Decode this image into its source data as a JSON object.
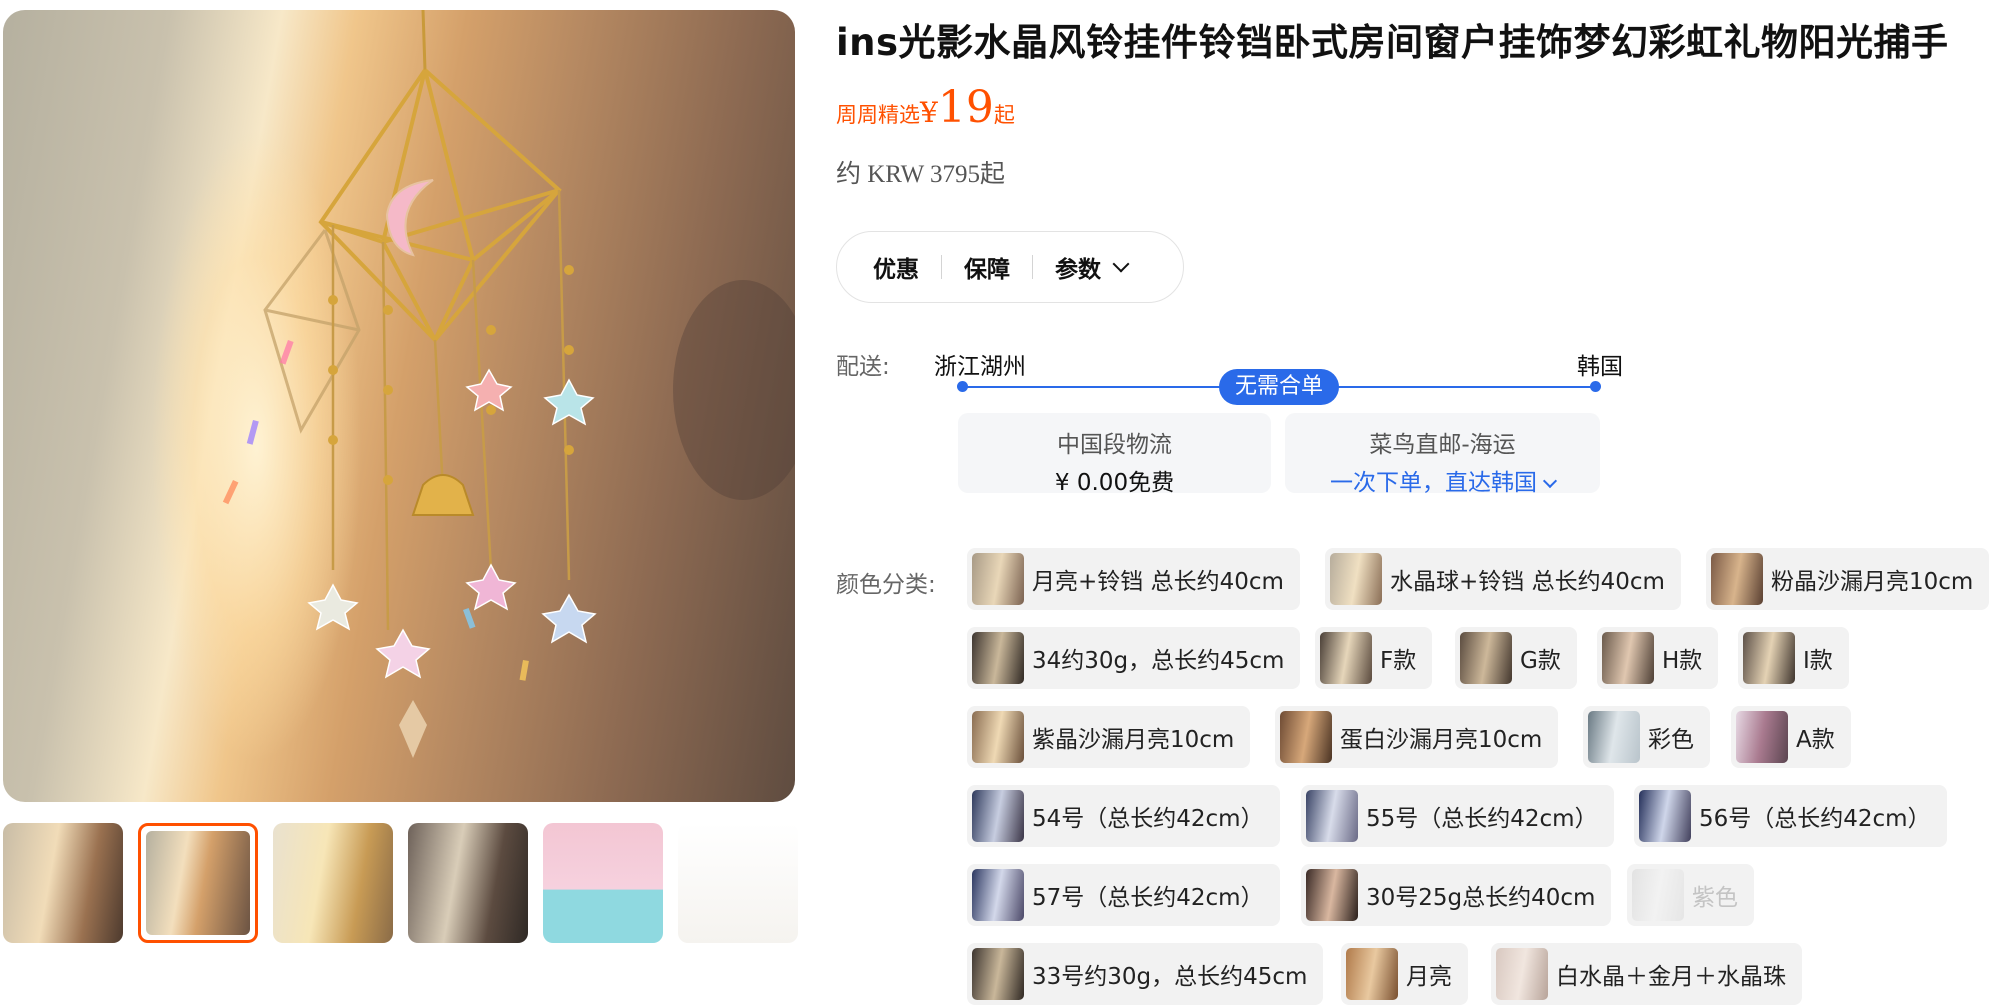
{
  "product": {
    "title": "ins光影水晶风铃挂件铃铛卧式房间窗户挂饰梦幻彩虹礼物阳光捕手",
    "price_tag": "周周精选",
    "currency_symbol": "¥",
    "price": "19",
    "price_suffix": "起",
    "converted_price": "约 KRW 3795起"
  },
  "tabs": [
    {
      "label": "优惠"
    },
    {
      "label": "保障"
    },
    {
      "label": "参数"
    }
  ],
  "delivery": {
    "label": "配送:",
    "from": "浙江湖州",
    "to": "韩国",
    "badge": "无需合单",
    "accent_color": "#2a6ae9",
    "cards": [
      {
        "line1": "中国段物流",
        "line2": "¥ 0.00免费"
      },
      {
        "line1": "菜鸟直邮-海运",
        "line2": "一次下单，直达韩国"
      }
    ]
  },
  "colors": {
    "label": "颜色分类:",
    "options": [
      {
        "text": "月亮+铃铛 总长约40cm"
      },
      {
        "text": "水晶球+铃铛 总长约40cm"
      },
      {
        "text": "粉晶沙漏月亮10cm"
      },
      {
        "text": "34约30g，总长约45cm"
      },
      {
        "text": "F款"
      },
      {
        "text": "G款"
      },
      {
        "text": "H款"
      },
      {
        "text": "I款"
      },
      {
        "text": "紫晶沙漏月亮10cm"
      },
      {
        "text": "蛋白沙漏月亮10cm"
      },
      {
        "text": "彩色"
      },
      {
        "text": "A款"
      },
      {
        "text": "54号（总长约42cm）"
      },
      {
        "text": "55号（总长约42cm）"
      },
      {
        "text": "56号（总长约42cm）"
      },
      {
        "text": "57号（总长约42cm）"
      },
      {
        "text": "30号25g总长约40cm"
      },
      {
        "text": "紫色",
        "disabled": true
      },
      {
        "text": "33号约30g，总长约45cm"
      },
      {
        "text": "月亮"
      },
      {
        "text": "白水晶＋金月＋水晶珠"
      }
    ]
  },
  "gallery": {
    "thumb_count": 6,
    "selected_index": 1,
    "accent_color": "#ff5000"
  }
}
